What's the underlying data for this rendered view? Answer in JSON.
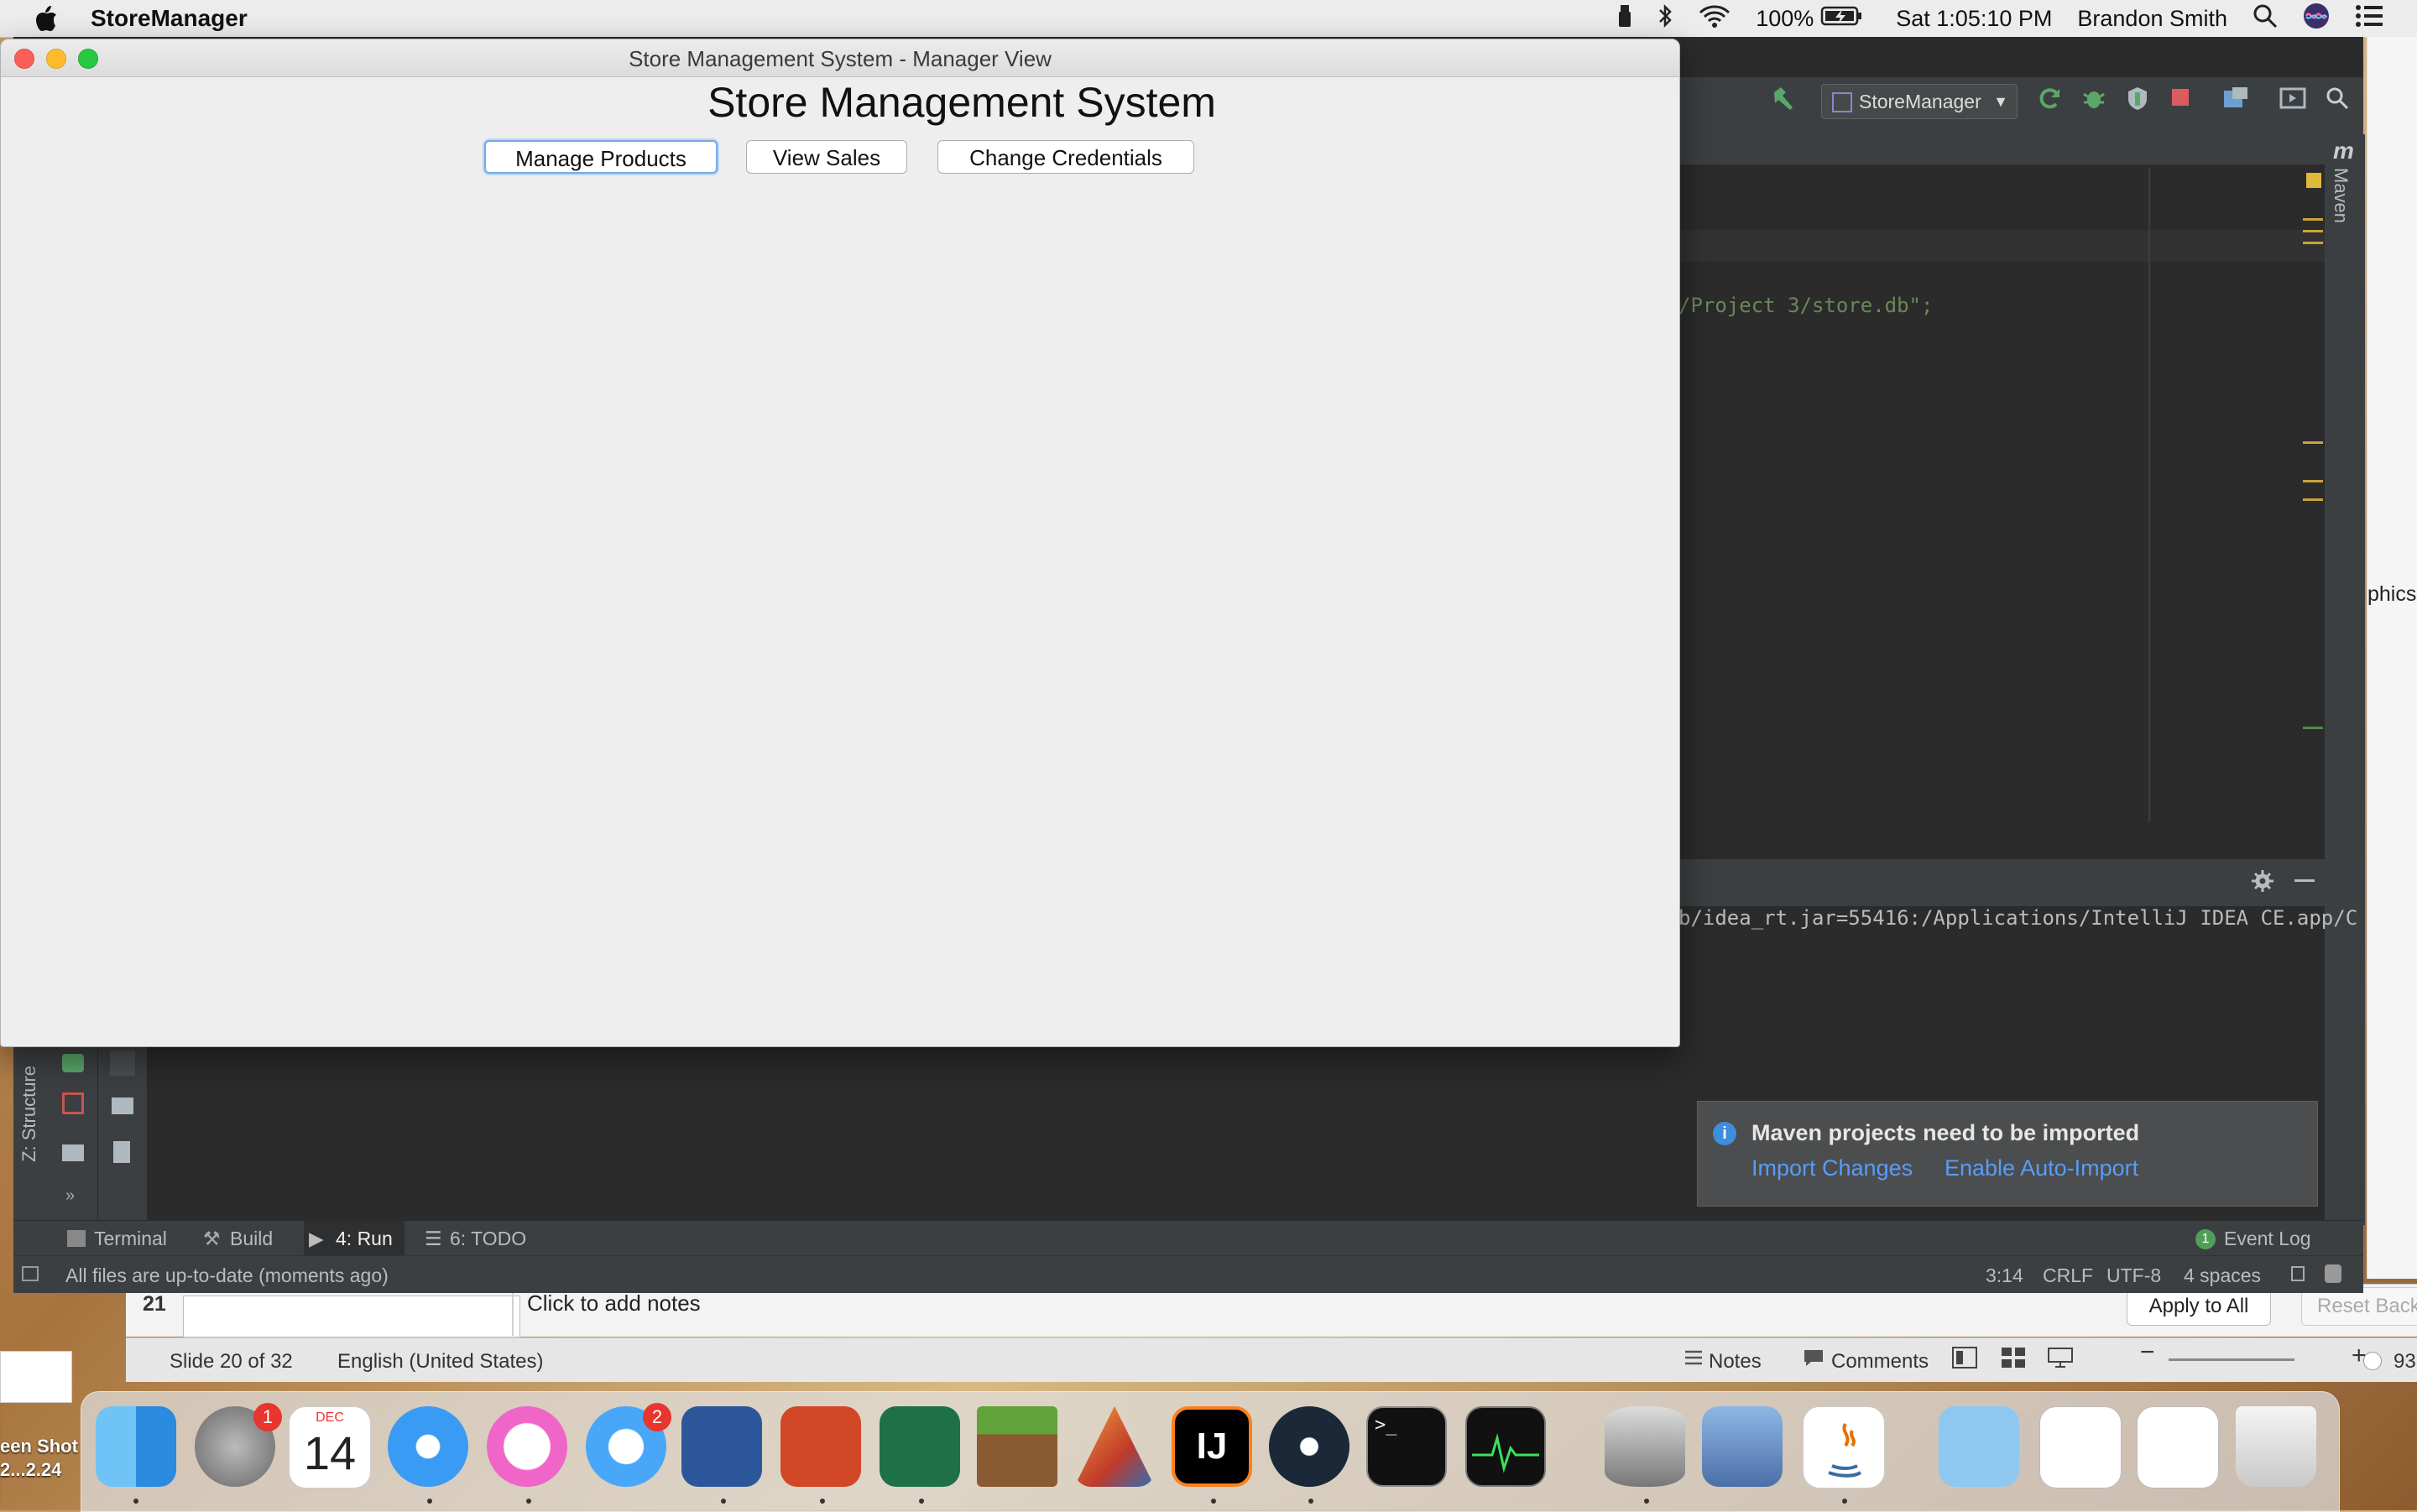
{
  "menubar": {
    "app_name": "StoreManager",
    "battery": "100%",
    "clock": "Sat 1:05:10 PM",
    "user": "Brandon Smith",
    "icons": [
      "apple-icon",
      "usb-icon",
      "bluetooth-icon",
      "wifi-icon",
      "battery-icon",
      "search-icon",
      "siri-icon",
      "notification-center-icon"
    ]
  },
  "swing_window": {
    "title": "Store Management System - Manager View",
    "heading": "Store Management System",
    "buttons": {
      "manage_products": "Manage Products",
      "view_sales": "View Sales",
      "change_credentials": "Change Credentials"
    }
  },
  "intellij": {
    "run_config": "StoreManager",
    "code_fragment": "/Project 3/store.db\";",
    "console_line": "b/idea_rt.jar=55416:/Applications/IntelliJ IDEA CE.app/C",
    "maven_side_label": "Maven",
    "structure_side_label": "Z: Structure",
    "tabs": {
      "terminal": "Terminal",
      "build": "Build",
      "run": "4: Run",
      "todo": "6: TODO",
      "event_log": "Event Log",
      "event_count": "1"
    },
    "status": {
      "message": "All files are up-to-date (moments ago)",
      "position": "3:14",
      "line_sep": "CRLF",
      "encoding": "UTF-8",
      "indent": "4 spaces"
    },
    "maven_popup": {
      "title": "Maven projects need to be imported",
      "import_changes": "Import Changes",
      "enable_auto_import": "Enable Auto-Import"
    }
  },
  "powerpoint": {
    "slide_index": "21",
    "notes_placeholder": "Click to add notes",
    "apply_to_all": "Apply to All",
    "reset_background": "Reset Back",
    "slide_count": "Slide 20 of 32",
    "language": "English (United States)",
    "notes": "Notes",
    "comments": "Comments",
    "zoom": "93"
  },
  "right_window": {
    "fragment": "phics"
  },
  "desktop": {
    "screenshot_label_1": "een Shot",
    "screenshot_label_2": "2...2.24"
  },
  "dock": {
    "apps": [
      "finder-icon",
      "system-preferences-icon",
      "calendar-icon",
      "safari-icon",
      "itunes-icon",
      "messages-icon",
      "word-icon",
      "powerpoint-icon",
      "excel-icon",
      "minecraft-icon",
      "matlab-icon",
      "intellij-icon",
      "steam-icon",
      "terminal-icon",
      "activity-monitor-icon",
      "database-icon",
      "preview-icon",
      "java-icon",
      "downloads-icon",
      "document-thumb-1",
      "document-thumb-2",
      "trash-icon"
    ],
    "calendar_month": "DEC",
    "calendar_day": "14",
    "system_prefs_badge": "1",
    "messages_badge": "2"
  }
}
